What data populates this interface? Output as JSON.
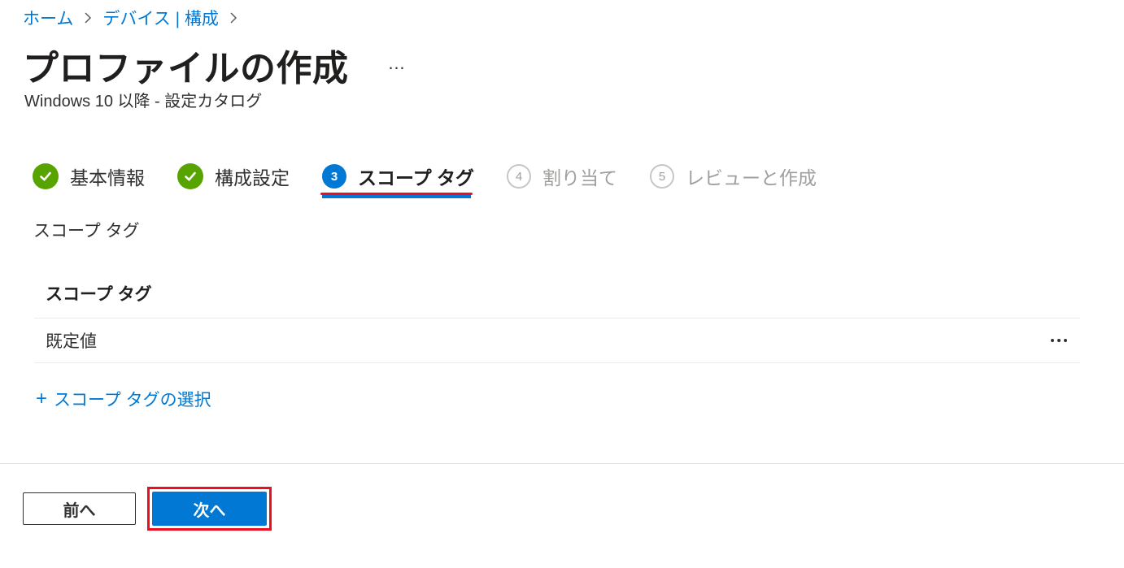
{
  "breadcrumb": {
    "items": [
      "ホーム",
      "デバイス | 構成"
    ]
  },
  "header": {
    "title": "プロファイルの作成",
    "more": "…",
    "subtitle": "Windows 10 以降 - 設定カタログ"
  },
  "stepper": {
    "steps": [
      {
        "number": "1",
        "label": "基本情報",
        "state": "completed"
      },
      {
        "number": "2",
        "label": "構成設定",
        "state": "completed"
      },
      {
        "number": "3",
        "label": "スコープ タグ",
        "state": "current"
      },
      {
        "number": "4",
        "label": "割り当て",
        "state": "upcoming"
      },
      {
        "number": "5",
        "label": "レビューと作成",
        "state": "upcoming"
      }
    ]
  },
  "section": {
    "heading": "スコープ タグ",
    "table_header": "スコープ タグ",
    "rows": [
      {
        "value": "既定値"
      }
    ],
    "add_link": "スコープ タグの選択",
    "add_symbol": "+"
  },
  "footer": {
    "prev_label": "前へ",
    "next_label": "次へ"
  },
  "colors": {
    "accent": "#0078d4",
    "success": "#57a300",
    "highlight": "#e81123",
    "muted": "#a19f9d"
  }
}
